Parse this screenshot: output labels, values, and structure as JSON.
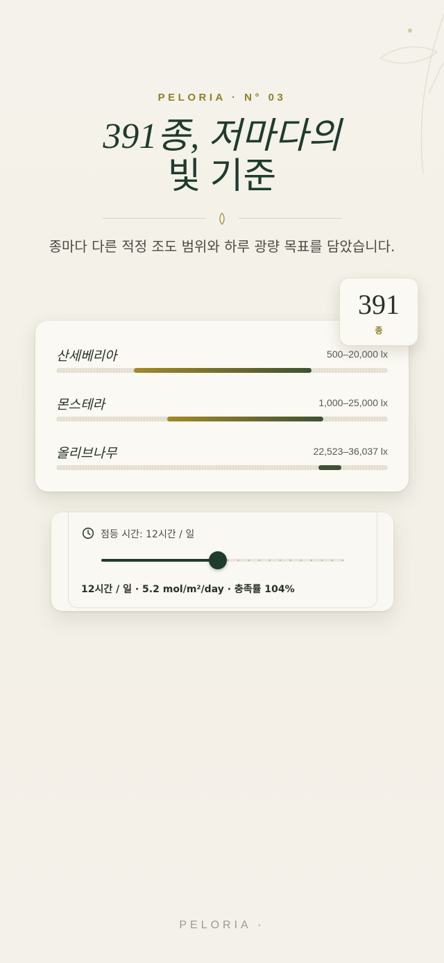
{
  "hero": {
    "eyebrow": "PELORIA · N° 03",
    "title_line1": "391종, 저마다의",
    "title_line2": "빛 기준",
    "subtitle": "종마다 다른 적정 조도 범위와 하루 광량 목표를 담았습니다."
  },
  "count_badge": {
    "value": "391",
    "unit": "종"
  },
  "species": [
    {
      "name": "산세베리아",
      "range_label": "500–20,000 lx",
      "band_start_frac": 0.235,
      "band_end_frac": 0.77,
      "band_color": "#6d6a2f"
    },
    {
      "name": "몬스테라",
      "range_label": "1,000–25,000 lx",
      "band_start_frac": 0.335,
      "band_end_frac": 0.805,
      "band_color": "#6d6a2f"
    },
    {
      "name": "올리브나무",
      "range_label": "22,523–36,037 lx",
      "band_start_frac": 0.79,
      "band_end_frac": 0.86,
      "band_color": "#3f5134"
    }
  ],
  "light": {
    "icon": "clock-icon",
    "label": "점등 시간: 12시간 / 일",
    "slider_fraction": 0.48,
    "summary": "12시간 / 일 · 5.2 mol/m²/day · 충족률 104%"
  },
  "footer": {
    "brand": "PELORIA",
    "dot": "·"
  },
  "colors": {
    "accent_gold": "#8f7f2a",
    "forest": "#1f3b2d",
    "background": "#f4f2ea"
  }
}
